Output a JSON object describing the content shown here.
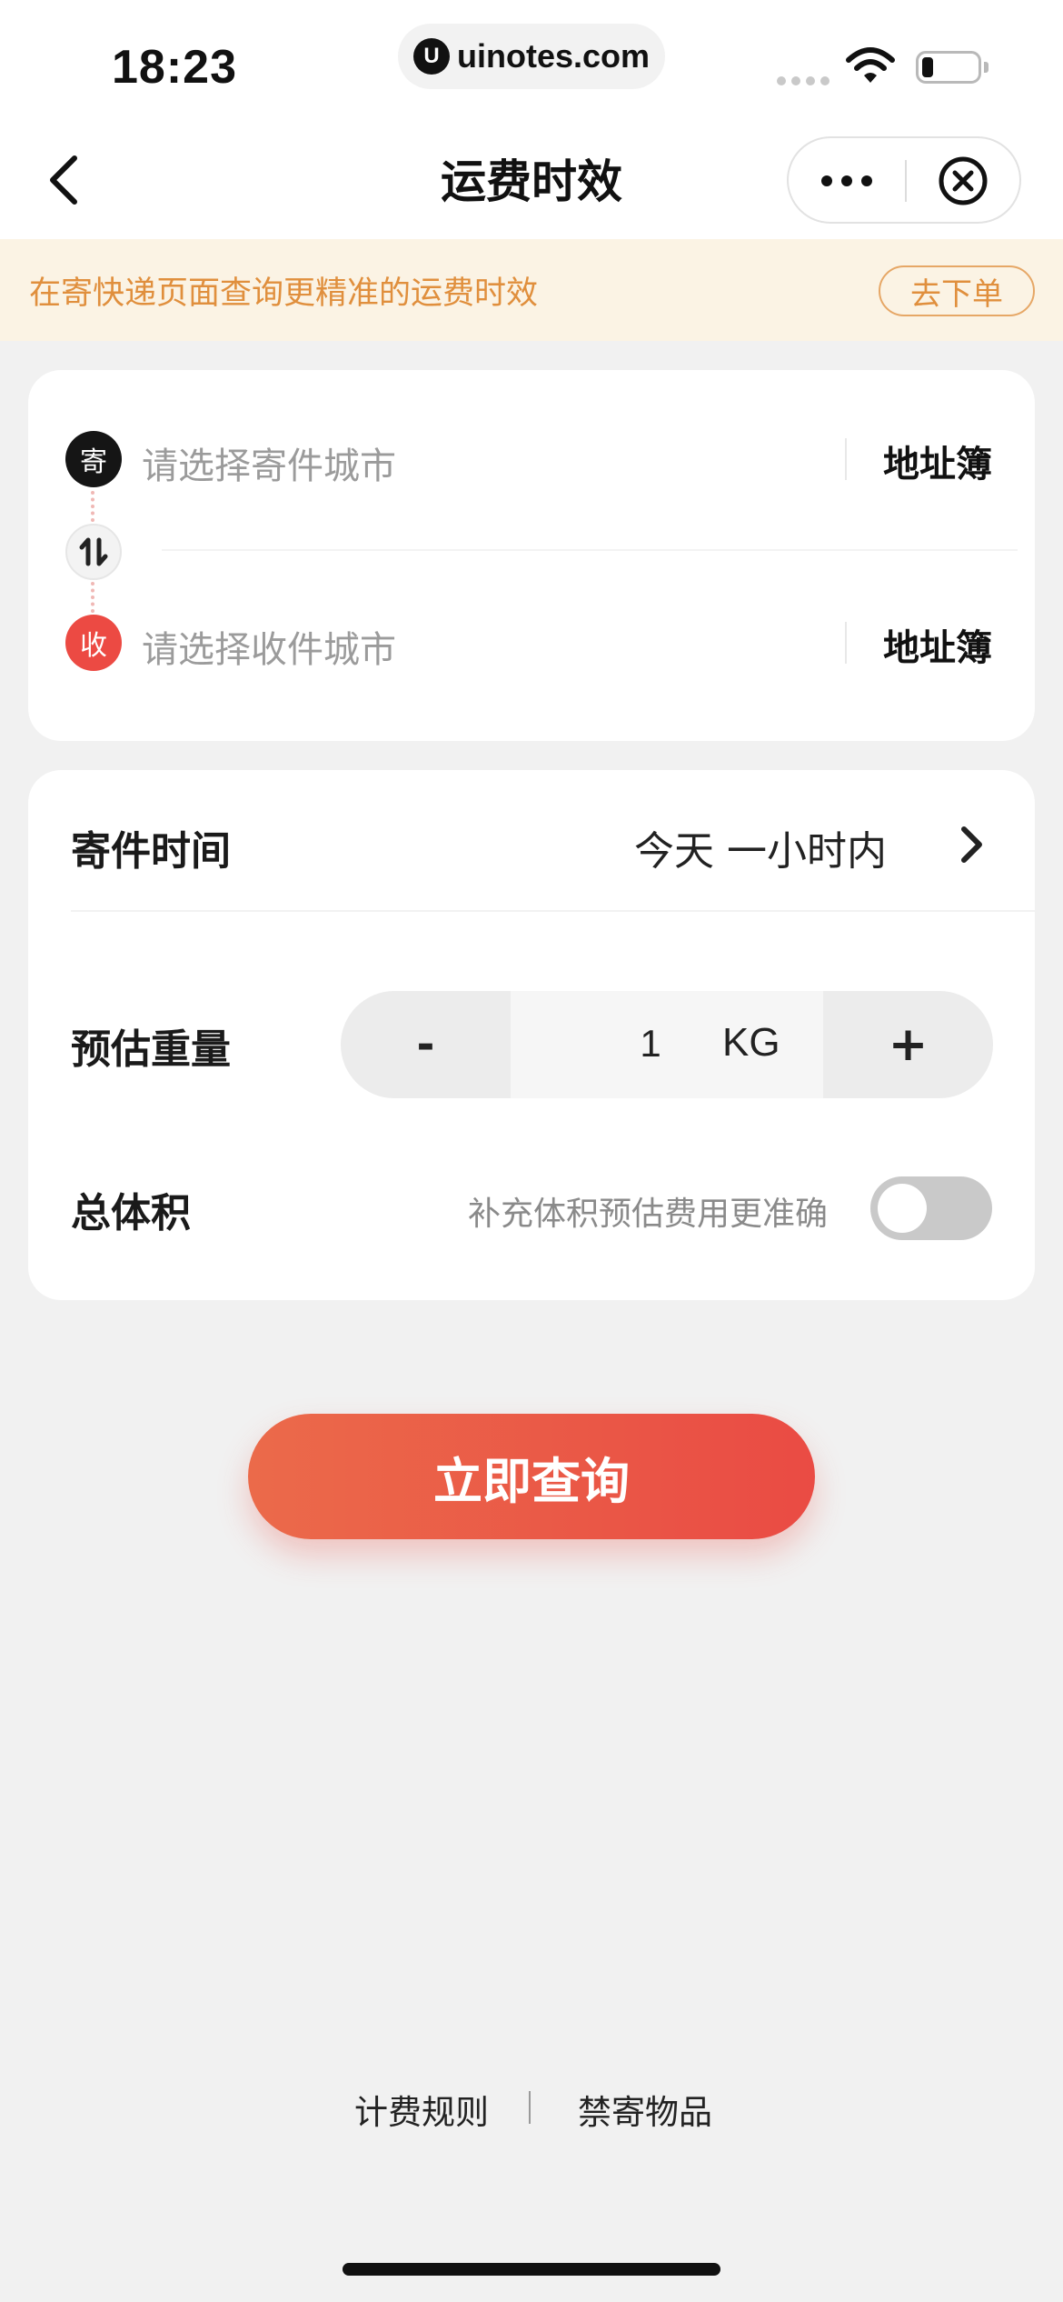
{
  "status_bar": {
    "time": "18:23",
    "site_logo": "U",
    "site": "uinotes.com"
  },
  "nav": {
    "title": "运费时效"
  },
  "notice": {
    "text": "在寄快递页面查询更精准的运费时效",
    "button": "去下单",
    "color": "#e08f3d"
  },
  "address": {
    "send": {
      "badge": "寄",
      "placeholder": "请选择寄件城市",
      "book": "地址簿"
    },
    "receive": {
      "badge": "收",
      "placeholder": "请选择收件城市",
      "book": "地址簿"
    },
    "swap_icon": "swap-vertical-icon"
  },
  "options": {
    "time": {
      "label": "寄件时间",
      "value": "今天 一小时内"
    },
    "weight": {
      "label": "预估重量",
      "minus": "-",
      "value": "1",
      "unit": "KG",
      "plus": "+"
    },
    "volume": {
      "label": "总体积",
      "hint": "补充体积预估费用更准确",
      "enabled": false
    }
  },
  "query_button": "立即查询",
  "footer": {
    "link1": "计费规则",
    "link2": "禁寄物品"
  },
  "colors": {
    "accent": "#ea4b44",
    "background": "#f1f1f1"
  }
}
